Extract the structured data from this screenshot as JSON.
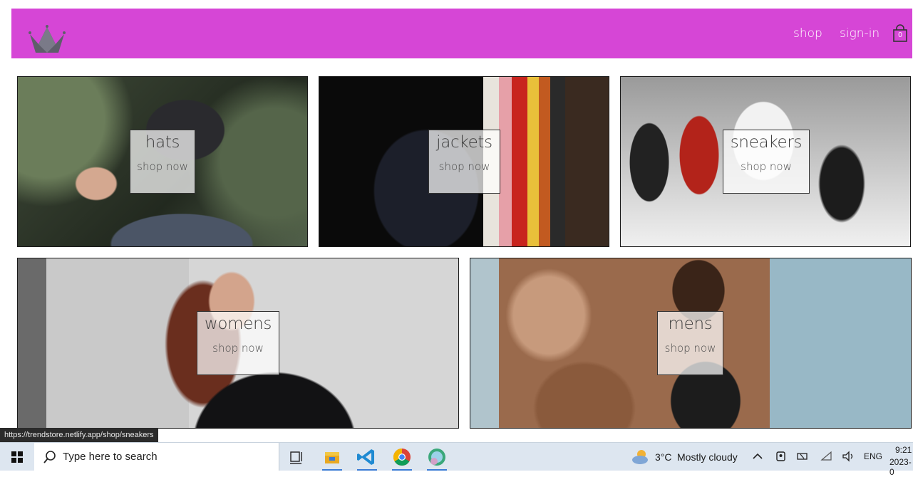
{
  "header": {
    "nav": {
      "shop": "shop",
      "signin": "sign-in"
    },
    "cart_count": "0",
    "accent_color": "#d646d6"
  },
  "categories": [
    {
      "title": "hats",
      "cta": "shop now",
      "icon": "hat-photo"
    },
    {
      "title": "jackets",
      "cta": "shop now",
      "icon": "jackets-photo"
    },
    {
      "title": "sneakers",
      "cta": "shop now",
      "icon": "sneakers-photo"
    },
    {
      "title": "womens",
      "cta": "shop now",
      "icon": "womens-photo"
    },
    {
      "title": "mens",
      "cta": "shop now",
      "icon": "mens-photo"
    }
  ],
  "status_url": "https://trendstore.netlify.app/shop/sneakers",
  "taskbar": {
    "search_placeholder": "Type here to search",
    "weather": {
      "temp": "3°C",
      "desc": "Mostly cloudy"
    },
    "lang": "ENG",
    "time": "9:21",
    "date": "2023-0"
  }
}
